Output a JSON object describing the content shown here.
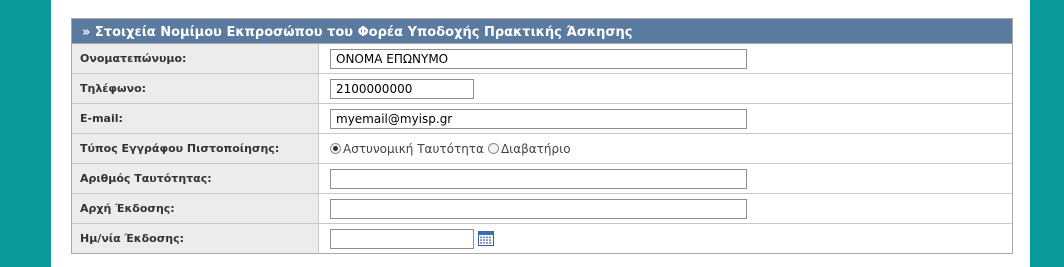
{
  "section": {
    "title": "» Στοιχεία Νομίμου Εκπροσώπου του Φορέα Υποδοχής Πρακτικής Άσκησης"
  },
  "fields": {
    "fullname": {
      "label": "Ονοματεπώνυμο:",
      "value": "ΟΝΟΜΑ ΕΠΩΝΥΜΟ"
    },
    "phone": {
      "label": "Τηλέφωνο:",
      "value": "2100000000"
    },
    "email": {
      "label": "E-mail:",
      "value": "myemail@myisp.gr"
    },
    "doc_type": {
      "label": "Τύπος Εγγράφου Πιστοποίησης:",
      "options": [
        "Αστυνομική Ταυτότητα",
        "Διαβατήριο"
      ],
      "selected": "Αστυνομική Ταυτότητα"
    },
    "id_number": {
      "label": "Αριθμός Ταυτότητας:",
      "value": ""
    },
    "issuing_authority": {
      "label": "Αρχή Έκδοσης:",
      "value": ""
    },
    "issue_date": {
      "label": "Ημ/νία Έκδοσης:",
      "value": "",
      "icon": "calendar-icon"
    }
  },
  "colors": {
    "background": "#0a9a9a",
    "header": "#5b7aa0",
    "label_bg": "#ececec"
  }
}
